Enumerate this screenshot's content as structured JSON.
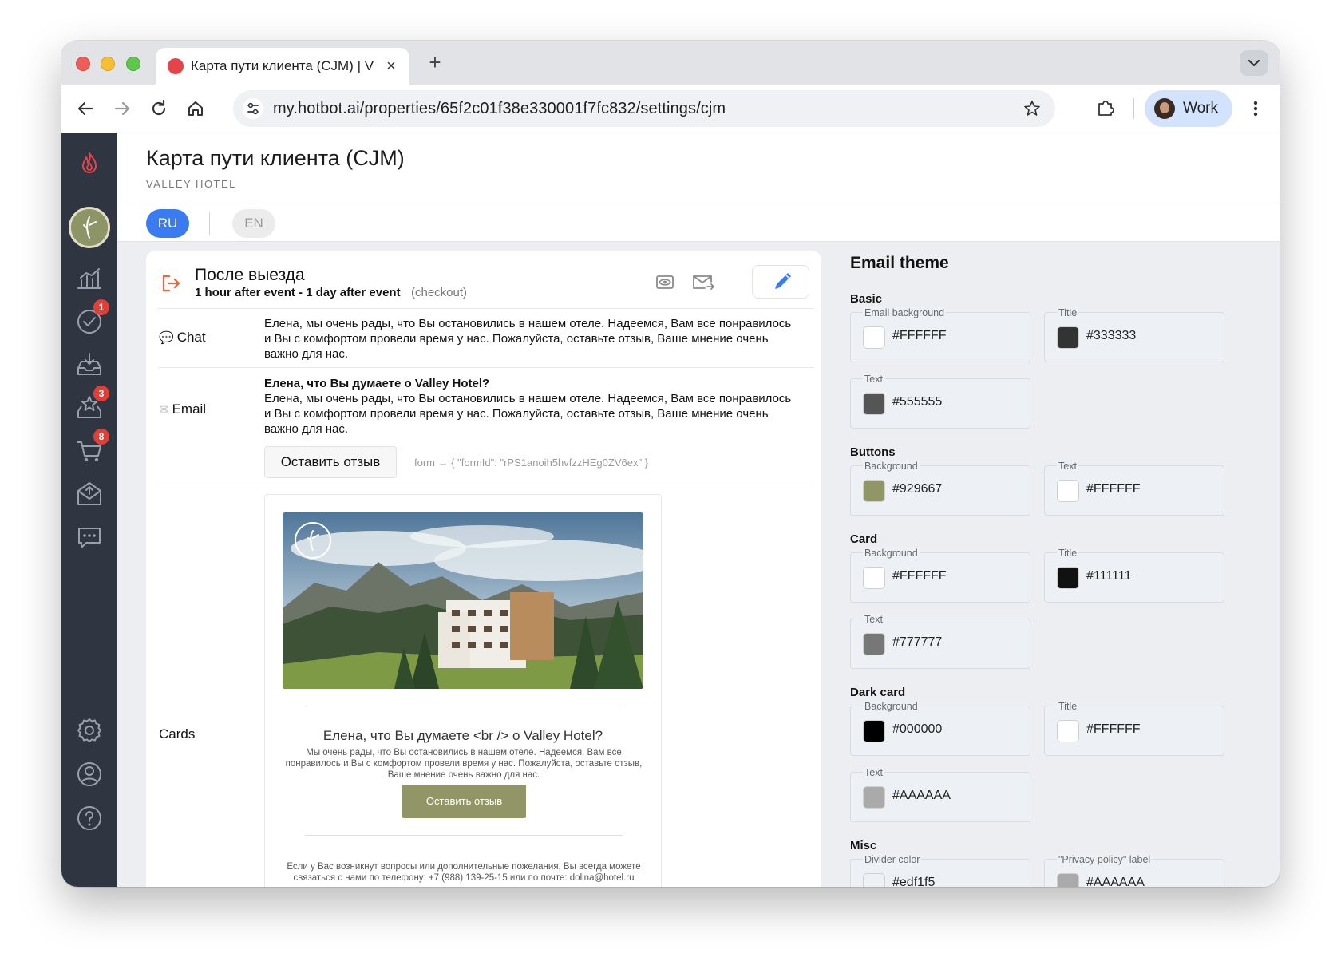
{
  "browser": {
    "tab_title": "Карта пути клиента (CJM) | V",
    "url": "my.hotbot.ai/properties/65f2c01f38e330001f7fc832/settings/cjm",
    "profile_label": "Work"
  },
  "sidebar": {
    "badges": {
      "tasks": "1",
      "reviews": "3",
      "orders": "8"
    }
  },
  "page": {
    "title": "Карта пути клиента (CJM)",
    "subtitle": "VALLEY HOTEL",
    "languages": [
      "RU",
      "EN"
    ],
    "active_language": "RU"
  },
  "stage": {
    "title": "После выезда",
    "timing": "1 hour after event - 1 day after event",
    "event": "(checkout)",
    "channels": {
      "chat": {
        "label": "Chat",
        "text": "Елена, мы очень рады, что Вы остановились в нашем отеле. Надеемся, Вам все понравилось и Вы с комфортом провели время у нас. Пожалуйста, оставьте отзыв, Ваше мнение очень важно для нас."
      },
      "email": {
        "label": "Email",
        "subject": "Елена, что Вы думаете о Valley Hotel?",
        "text": "Елена, мы очень рады, что Вы остановились в нашем отеле. Надеемся, Вам все понравилось и Вы с комфортом провели время у нас. Пожалуйста, оставьте отзыв, Ваше мнение очень важно для нас.",
        "button_label": "Оставить отзыв",
        "form_meta": "form → { \"formId\": \"rPS1anoih5hvfzzHEg0ZV6ex\" }"
      },
      "cards": {
        "label": "Cards",
        "title": "Елена, что Вы думаете <br /> о Valley Hotel?",
        "text": "Мы очень рады, что Вы остановились в нашем отеле. Надеемся, Вам все понравилось и Вы с комфортом провели время у нас. Пожалуйста, оставьте отзыв, Ваше мнение очень важно для нас.",
        "button_label": "Оставить отзыв",
        "footer": "Если у Вас возникнут вопросы или дополнительные пожелания, Вы всегда можете связаться с нами по телефону: +7 (988) 139-25-15 или по почте: dolina@hotel.ru"
      }
    }
  },
  "email_theme": {
    "title": "Email theme",
    "basic": {
      "label": "Basic",
      "email_background": {
        "label": "Email background",
        "value": "#FFFFFF"
      },
      "title": {
        "label": "Title",
        "value": "#333333"
      },
      "text": {
        "label": "Text",
        "value": "#555555"
      }
    },
    "buttons": {
      "label": "Buttons",
      "background": {
        "label": "Background",
        "value": "#929667"
      },
      "text": {
        "label": "Text",
        "value": "#FFFFFF"
      }
    },
    "card": {
      "label": "Card",
      "background": {
        "label": "Background",
        "value": "#FFFFFF"
      },
      "title": {
        "label": "Title",
        "value": "#111111"
      },
      "text": {
        "label": "Text",
        "value": "#777777"
      }
    },
    "dark_card": {
      "label": "Dark card",
      "background": {
        "label": "Background",
        "value": "#000000"
      },
      "title": {
        "label": "Title",
        "value": "#FFFFFF"
      },
      "text": {
        "label": "Text",
        "value": "#AAAAAA"
      }
    },
    "misc": {
      "label": "Misc",
      "divider_color": {
        "label": "Divider color",
        "value": "#edf1f5"
      },
      "privacy_label": {
        "label": "\"Privacy policy\" label",
        "value": "#AAAAAA"
      }
    }
  },
  "colors": {
    "accent": "#3b7bf1",
    "sidebar_bg": "#303641",
    "brand_button": "#929667",
    "stage_icon": "#e8663c",
    "badge": "#e03f38"
  }
}
